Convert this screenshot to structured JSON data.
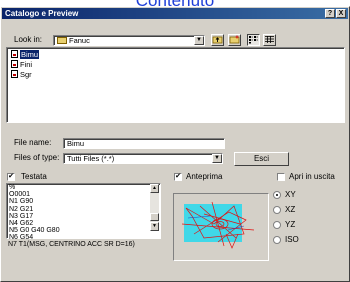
{
  "header": {
    "text": "Contenuto"
  },
  "window": {
    "title": "Catalogo e Preview",
    "help_btn": "?",
    "close_btn": "X"
  },
  "look_in": {
    "label": "Look in:",
    "value": "Fanuc",
    "arrow": "▼"
  },
  "toolbar": {
    "up_icon": "folder-up-icon",
    "new_icon": "new-folder-icon",
    "list_icon": "list-view-icon",
    "details_icon": "details-view-icon"
  },
  "files": [
    {
      "name": "Bimu",
      "selected": true
    },
    {
      "name": "Fini",
      "selected": false
    },
    {
      "name": "Sgr",
      "selected": false
    }
  ],
  "file_name": {
    "label": "File name:",
    "value": "Bimu"
  },
  "file_type": {
    "label": "Files of type:",
    "value": "Tutti Files (*.*)",
    "arrow": "▼"
  },
  "exit_button": "Esci",
  "testata": {
    "label": "Testata",
    "checked": true,
    "lines": [
      "%",
      "O0001",
      "N1 G90",
      "N2 G21",
      "N3 G17",
      "N4 G62",
      "N5 G0 G40 G80",
      "N6 G54",
      "N7 T1(MSG, CENTRINO ACC SR D=16)"
    ]
  },
  "anteprima": {
    "label": "Anteprima",
    "checked": true
  },
  "apri": {
    "label": "Apri in uscita",
    "checked": false
  },
  "views": [
    {
      "label": "XY",
      "selected": true
    },
    {
      "label": "XZ",
      "selected": false
    },
    {
      "label": "YZ",
      "selected": false
    },
    {
      "label": "ISO",
      "selected": false
    }
  ],
  "colors": {
    "title_bar": "#0a246a",
    "header": "#1f3fd8",
    "preview_bg": "#40d8e8",
    "toolpath": "#e01010"
  }
}
